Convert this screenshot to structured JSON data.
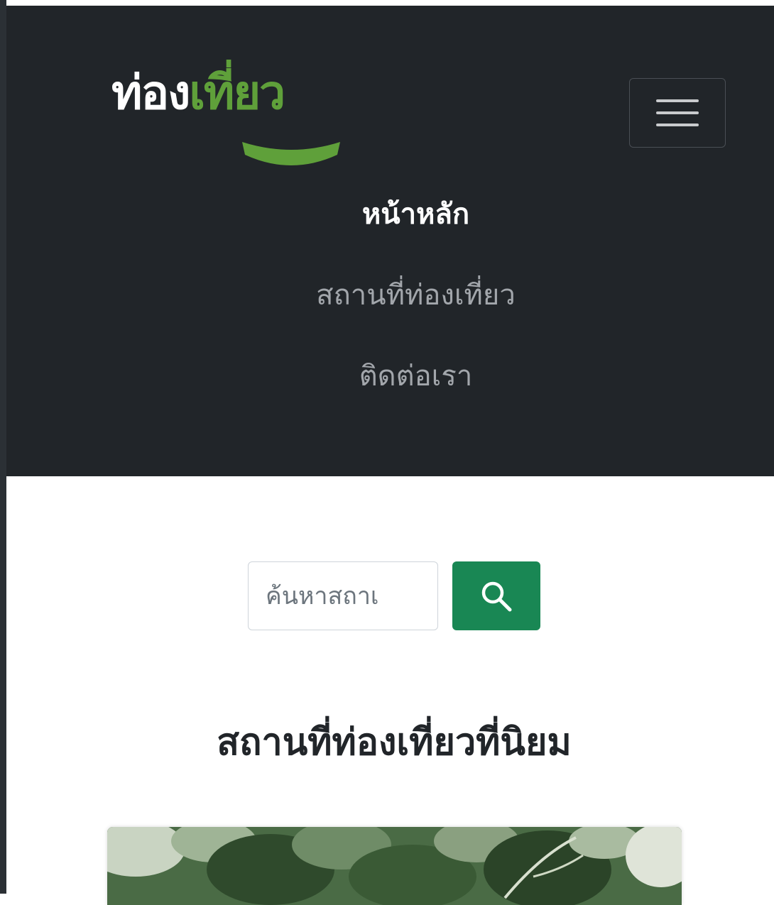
{
  "brand": {
    "part1": "ท่อง",
    "part2": "เที่ยว"
  },
  "nav": {
    "toggler_icon": "hamburger-menu-icon",
    "links": [
      {
        "label": "หน้าหลัก",
        "active": true
      },
      {
        "label": "สถานที่ท่องเที่ยว",
        "active": false
      },
      {
        "label": "ติดต่อเรา",
        "active": false
      }
    ]
  },
  "search": {
    "placeholder": "ค้นหาสถาเ",
    "button_icon": "search-icon"
  },
  "section": {
    "title": "สถานที่ท่องเที่ยวที่นิยม"
  },
  "colors": {
    "navbar_bg": "#212529",
    "brand_green": "#5fa03a",
    "search_button": "#198754"
  }
}
